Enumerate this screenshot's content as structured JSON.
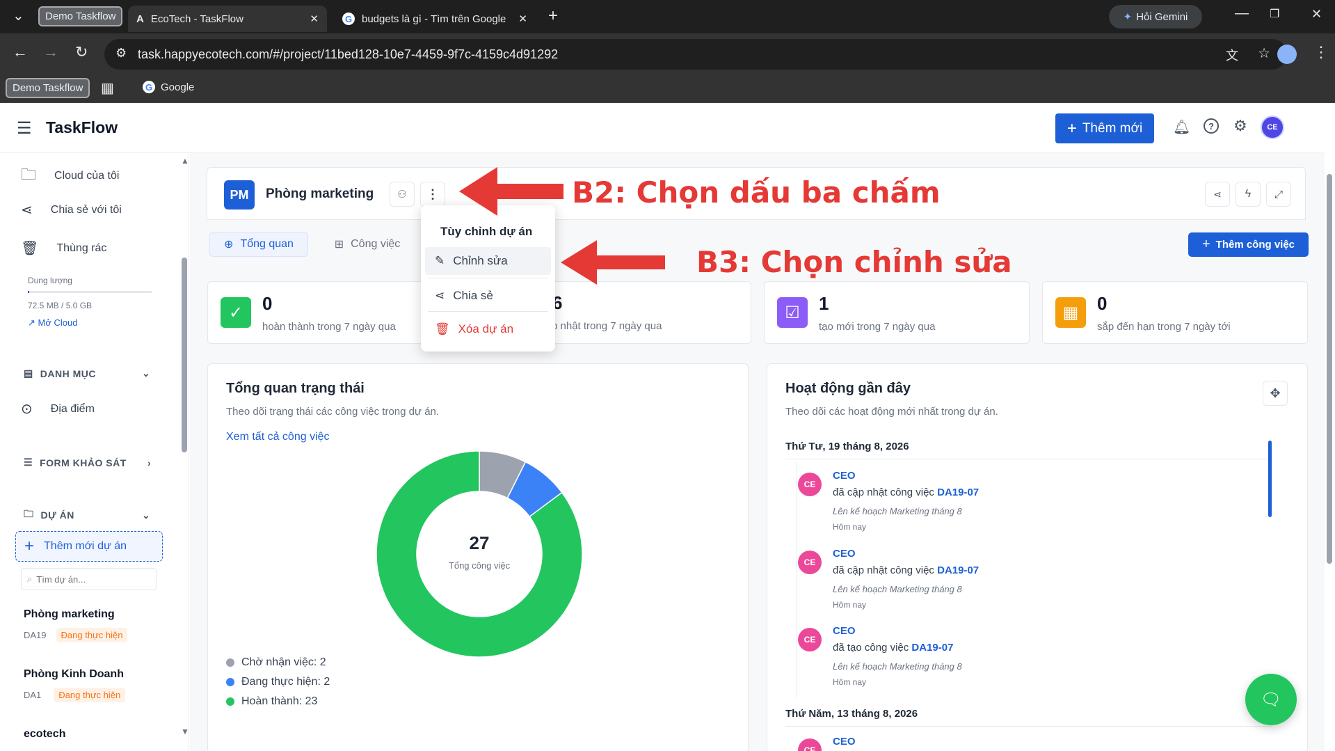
{
  "browser": {
    "tab_group": "Demo Taskflow",
    "tabs": [
      {
        "title": "EcoTech - TaskFlow",
        "active": true
      },
      {
        "title": "budgets là gì - Tìm trên Google",
        "active": false
      }
    ],
    "gemini_button": "Hỏi Gemini",
    "url": "task.happyecotech.com/#/project/11bed128-10e7-4459-9f7c-4159c4d91292",
    "bookmarks": [
      "Demo Taskflow",
      "Google"
    ]
  },
  "app": {
    "title": "TaskFlow",
    "add_new": "Thêm mới",
    "avatar": "CE",
    "accent": "#1d5fd6"
  },
  "sidebar": {
    "items": [
      {
        "label": "Cloud của tôi",
        "icon": "folder-icon"
      },
      {
        "label": "Chia sẻ với tôi",
        "icon": "share-icon"
      },
      {
        "label": "Thùng rác",
        "icon": "trash-icon"
      }
    ],
    "storage": {
      "label": "Dung lượng",
      "usage": "72.5 MB / 5.0 GB",
      "used_fraction": 0.014,
      "open_cloud": "Mở Cloud"
    },
    "category_header": "DANH MỤC",
    "category_items": [
      {
        "label": "Địa điểm",
        "icon": "location-pin-icon"
      }
    ],
    "survey_header": "FORM KHẢO SÁT",
    "project_header": "DỰ ÁN",
    "add_project": "Thêm mới dự án",
    "search_placeholder": "Tìm dự án...",
    "projects": [
      {
        "name": "Phòng marketing",
        "code": "DA19",
        "status": "Đang thực hiện"
      },
      {
        "name": "Phòng Kinh Doanh",
        "code": "DA1",
        "status": "Đang thực hiện"
      },
      {
        "name": "ecotech"
      }
    ]
  },
  "project": {
    "badge": "PM",
    "name": "Phòng marketing",
    "tabs": [
      "Tổng quan",
      "Công việc"
    ],
    "add_task": "Thêm công việc"
  },
  "menu": {
    "title": "Tùy chỉnh dự án",
    "items": [
      {
        "label": "Chỉnh sửa",
        "icon": "pencil-icon"
      },
      {
        "label": "Chia sẻ",
        "icon": "share-icon"
      },
      {
        "label": "Xóa dự án",
        "icon": "trash-icon",
        "danger": true
      }
    ]
  },
  "annotations": {
    "b2": "B2: Chọn dấu ba chấm",
    "b3": "B3: Chọn chỉnh sửa"
  },
  "stats": [
    {
      "value": "0",
      "label": "hoàn thành trong 7 ngày qua",
      "color": "#22c55e"
    },
    {
      "value": "6",
      "label": "p nhật trong 7 ngày qua",
      "color": "#3b82f6"
    },
    {
      "value": "1",
      "label": "tạo mới trong 7 ngày qua",
      "color": "#8b5cf6"
    },
    {
      "value": "0",
      "label": "sắp đến hạn trong 7 ngày tới",
      "color": "#f59e0b"
    }
  ],
  "status_overview": {
    "title": "Tổng quan trạng thái",
    "subtitle": "Theo dõi trạng thái các công việc trong dự án.",
    "link": "Xem tất cả công việc",
    "total": "27",
    "total_label": "Tổng công việc",
    "legend": [
      "Chờ nhận việc: 2",
      "Đang thực hiện: 2",
      "Hoàn thành: 23"
    ]
  },
  "chart_data": {
    "type": "pie",
    "categories": [
      "Chờ nhận việc",
      "Đang thực hiện",
      "Hoàn thành"
    ],
    "values": [
      2,
      2,
      23
    ],
    "colors": [
      "#9ca3af",
      "#3b82f6",
      "#22c55e"
    ],
    "donut": true
  },
  "activity": {
    "title": "Hoạt động gần đây",
    "subtitle": "Theo dõi các hoạt động mới nhất trong dự án.",
    "groups": [
      {
        "date": "Thứ Tư, 19 tháng 8, 2026",
        "entries": [
          {
            "user": "CEO",
            "action": "đã cập nhật công việc",
            "task": "DA19-07",
            "detail": "Lên kế hoạch Marketing tháng 8",
            "time": "Hôm nay"
          },
          {
            "user": "CEO",
            "action": "đã cập nhật công việc",
            "task": "DA19-07",
            "detail": "Lên kế hoạch Marketing tháng 8",
            "time": "Hôm nay"
          },
          {
            "user": "CEO",
            "action": "đã tạo công việc",
            "task": "DA19-07",
            "detail": "Lên kế hoạch Marketing tháng 8",
            "time": "Hôm nay"
          }
        ]
      },
      {
        "date": "Thứ Năm, 13 tháng 8, 2026",
        "entries": [
          {
            "user": "CEO"
          }
        ]
      }
    ]
  }
}
